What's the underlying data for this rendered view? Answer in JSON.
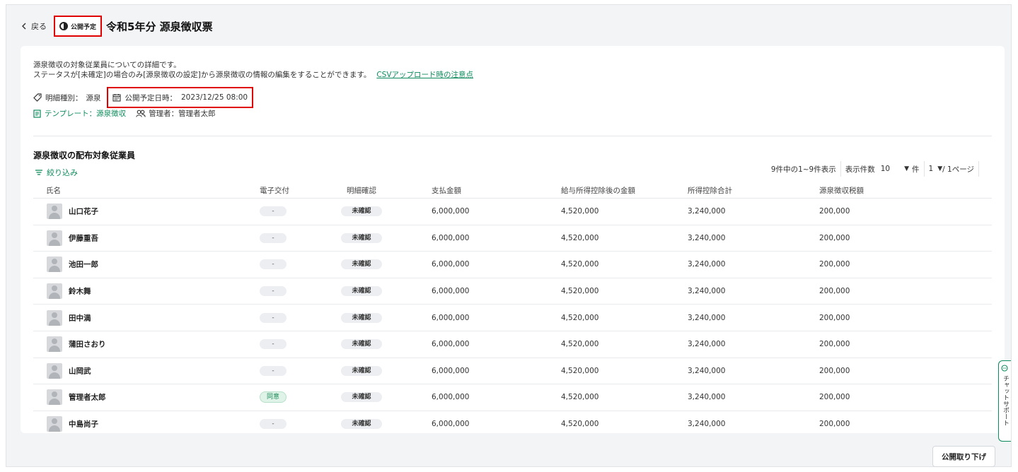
{
  "header": {
    "back_label": "戻る",
    "status_label": "公開予定",
    "page_title": "令和5年分 源泉徴収票"
  },
  "description": {
    "line1": "源泉徴収の対象従業員についての詳細です。",
    "line2": "ステータスが[未確定]の場合のみ[源泉徴収の設定]から源泉徴収の情報の編集をすることができます。",
    "csv_link": "CSVアップロード時の注意点"
  },
  "meta": {
    "type_label": "明細種別：",
    "type_value": "源泉",
    "publish_label": "公開予定日時：",
    "publish_value": "2023/12/25 08:00",
    "template_label": "テンプレート：源泉徴収",
    "manager_label": "管理者：管理者太郎"
  },
  "section": {
    "title": "源泉徴収の配布対象従業員",
    "filter_label": "絞り込み"
  },
  "pager": {
    "summary": "9件中の1~9件表示",
    "per_page_label": "表示件数",
    "per_page_value": "10",
    "per_page_unit": "件",
    "page_value": "1",
    "page_suffix": "/ 1ページ"
  },
  "table": {
    "columns": [
      "氏名",
      "電子交付",
      "明細確認",
      "支払金額",
      "給与所得控除後の金額",
      "所得控除合計",
      "源泉徴収税額"
    ],
    "rows": [
      {
        "name": "山口花子",
        "edelivery": "-",
        "confirm": "未確認",
        "pay": "6,000,000",
        "after": "4,520,000",
        "deduct": "3,240,000",
        "tax": "200,000"
      },
      {
        "name": "伊藤重吾",
        "edelivery": "-",
        "confirm": "未確認",
        "pay": "6,000,000",
        "after": "4,520,000",
        "deduct": "3,240,000",
        "tax": "200,000"
      },
      {
        "name": "池田一郎",
        "edelivery": "-",
        "confirm": "未確認",
        "pay": "6,000,000",
        "after": "4,520,000",
        "deduct": "3,240,000",
        "tax": "200,000"
      },
      {
        "name": "鈴木舞",
        "edelivery": "-",
        "confirm": "未確認",
        "pay": "6,000,000",
        "after": "4,520,000",
        "deduct": "3,240,000",
        "tax": "200,000"
      },
      {
        "name": "田中満",
        "edelivery": "-",
        "confirm": "未確認",
        "pay": "6,000,000",
        "after": "4,520,000",
        "deduct": "3,240,000",
        "tax": "200,000"
      },
      {
        "name": "蒲田さおり",
        "edelivery": "-",
        "confirm": "未確認",
        "pay": "6,000,000",
        "after": "4,520,000",
        "deduct": "3,240,000",
        "tax": "200,000"
      },
      {
        "name": "山岡武",
        "edelivery": "-",
        "confirm": "未確認",
        "pay": "6,000,000",
        "after": "4,520,000",
        "deduct": "3,240,000",
        "tax": "200,000"
      },
      {
        "name": "管理者太郎",
        "edelivery": "同意",
        "confirm": "未確認",
        "pay": "6,000,000",
        "after": "4,520,000",
        "deduct": "3,240,000",
        "tax": "200,000"
      },
      {
        "name": "中島尚子",
        "edelivery": "-",
        "confirm": "未確認",
        "pay": "6,000,000",
        "after": "4,520,000",
        "deduct": "3,240,000",
        "tax": "200,000"
      }
    ]
  },
  "footer": {
    "unpublish_label": "公開取り下げ"
  },
  "chat": {
    "label": "チャットサポート"
  },
  "colors": {
    "accent": "#0d8b5c",
    "highlight": "#e00000"
  }
}
